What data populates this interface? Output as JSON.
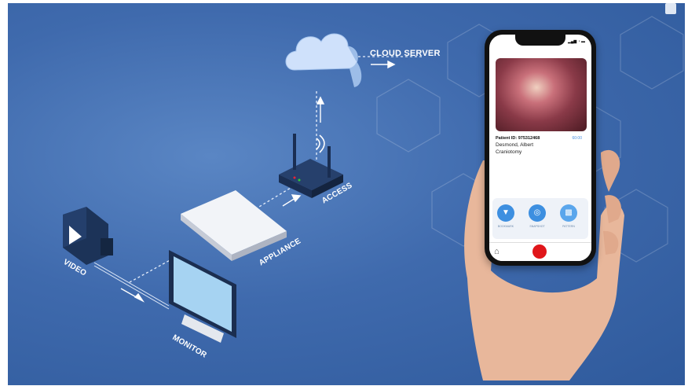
{
  "diagram": {
    "labels": {
      "cloud": "CLOUD SERVER",
      "access": "ACCESS",
      "appliance": "APPLIANCE",
      "video": "VIDEO",
      "monitor": "MONITOR"
    }
  },
  "phone_app": {
    "patient_id": "Patient ID: 975312468",
    "patient_id_link": "60:00",
    "patient_name": "Desmond, Albert",
    "procedure": "Craniotomy",
    "actions": [
      {
        "icon": "bookmark-icon",
        "caption": "BOOKMARK"
      },
      {
        "icon": "snapshot-icon",
        "caption": "SNAPSHOT"
      },
      {
        "icon": "pattern-icon",
        "caption": "PATTERN"
      }
    ],
    "tabbar": {
      "home_icon": "home-icon",
      "record_icon": "record-button"
    }
  },
  "colors": {
    "background": "#3f6aad",
    "record": "#e0161a",
    "accent": "#3d8fe0"
  }
}
